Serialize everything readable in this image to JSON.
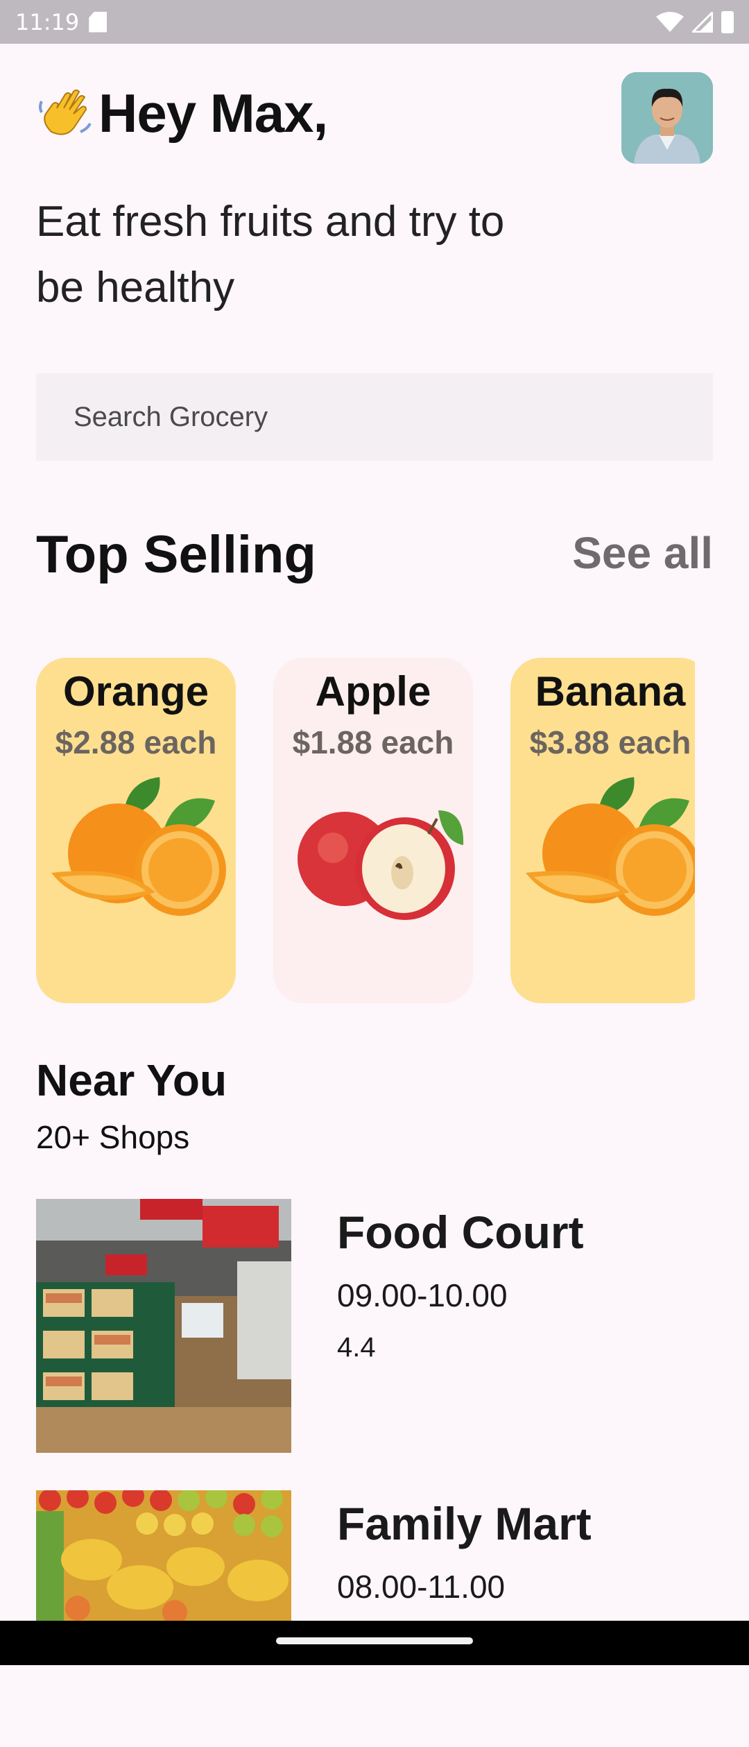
{
  "status_bar": {
    "time": "11:19",
    "icons": [
      "sd-card-icon",
      "wifi-icon",
      "signal-icon",
      "battery-icon"
    ]
  },
  "header": {
    "greeting": "Hey Max,",
    "wave_icon": "waving-hand-icon"
  },
  "subtitle": "Eat fresh fruits and try to be healthy",
  "search": {
    "placeholder": "Search Grocery"
  },
  "top_selling": {
    "title": "Top Selling",
    "see_all_label": "See all",
    "items": [
      {
        "name": "Orange",
        "price": "$2.88 each",
        "card_color": "#fddf8f"
      },
      {
        "name": "Apple",
        "price": "$1.88 each",
        "card_color": "#fdeef0"
      },
      {
        "name": "Banana",
        "price": "$3.88 each",
        "card_color": "#fddf8f"
      }
    ]
  },
  "near_you": {
    "title": "Near You",
    "subtitle": "20+ Shops",
    "shops": [
      {
        "name": "Food Court",
        "hours": "09.00-10.00",
        "rating": "4.4"
      },
      {
        "name": "Family Mart",
        "hours": "08.00-11.00"
      }
    ]
  }
}
